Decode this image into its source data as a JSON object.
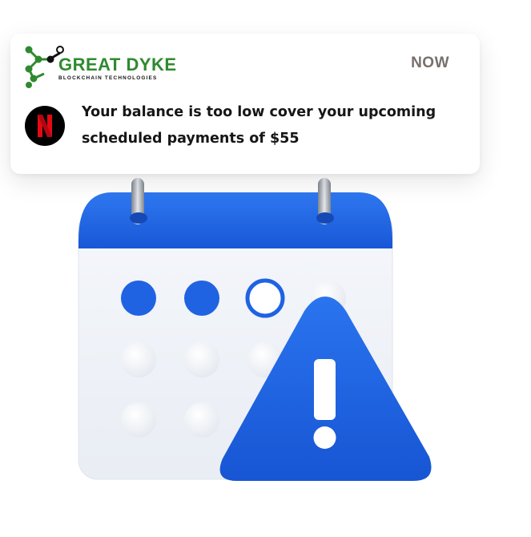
{
  "notification": {
    "brand": {
      "name": "GREAT DYKE",
      "tagline": "BLOCKCHAIN TECHNOLOGIES"
    },
    "time": "NOW",
    "app_icon": "netflix-icon",
    "message": "Your balance is too low cover your upcoming scheduled payments of $55"
  },
  "illustration": {
    "calendar_icon": "calendar-icon",
    "warning_icon": "warning-triangle-icon",
    "accent_color": "#1d63e0"
  }
}
